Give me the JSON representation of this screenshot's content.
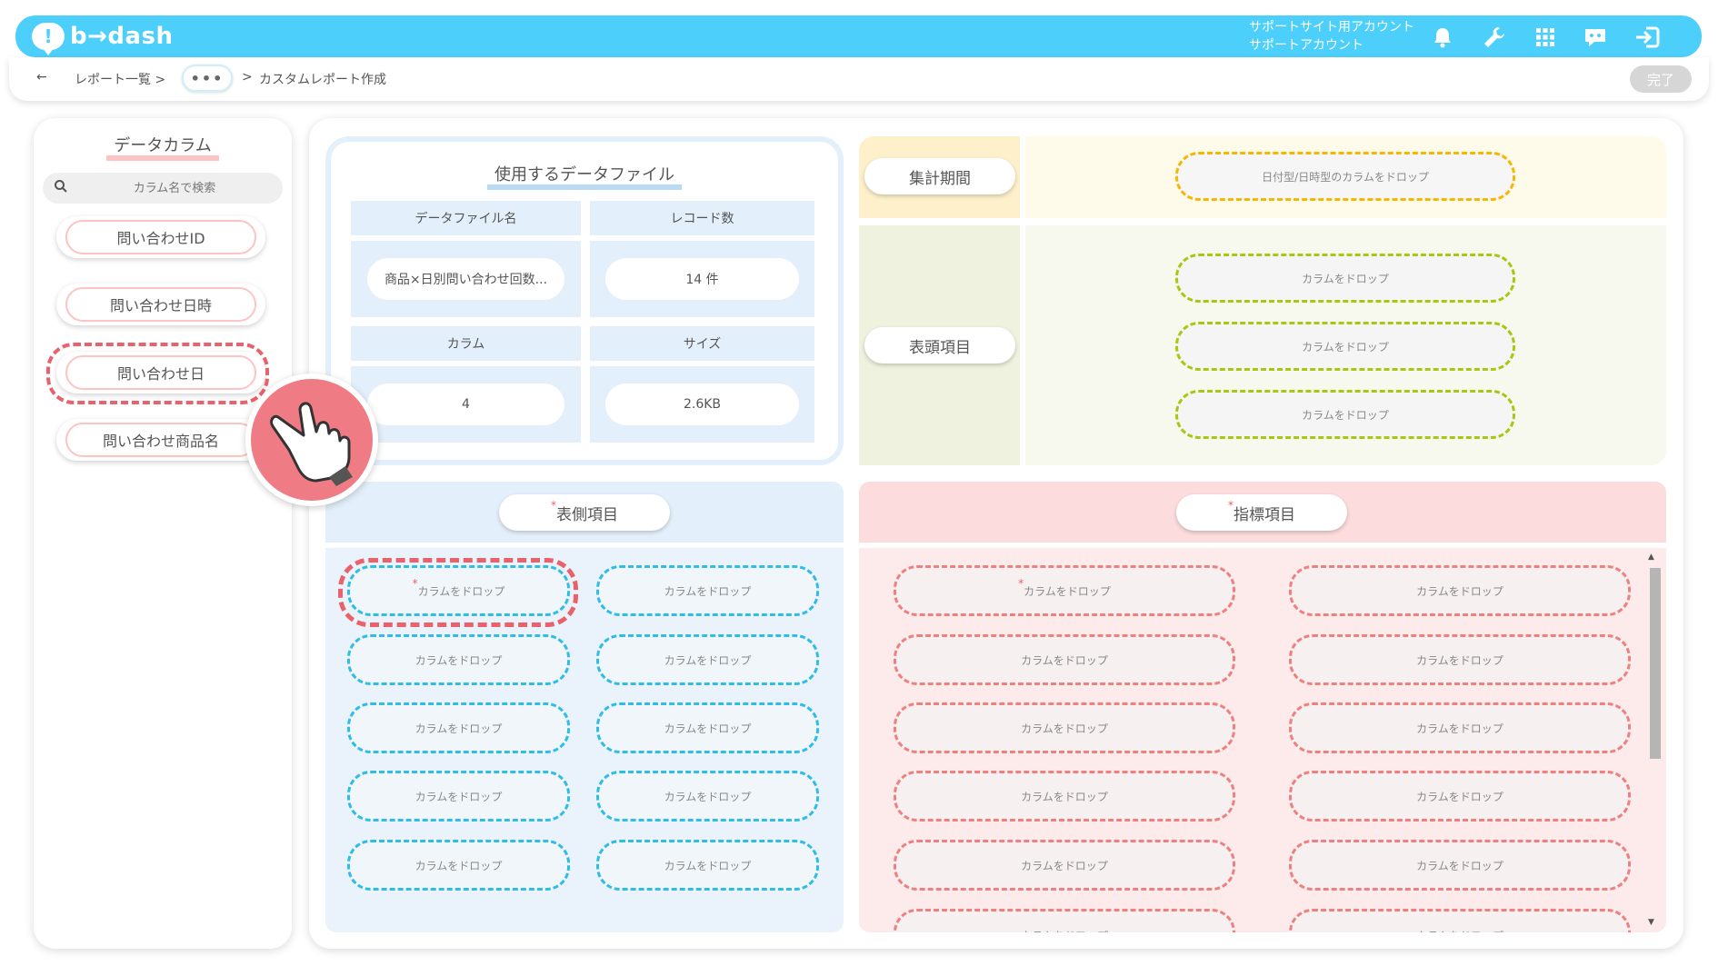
{
  "header": {
    "logo_text": "b→dash",
    "account_line1": "サポートサイト用アカウント",
    "account_line2": "サポートアカウント",
    "icons": [
      "bell-icon",
      "wrench-icon",
      "grid-icon",
      "support-chat-icon",
      "logout-icon"
    ]
  },
  "breadcrumb": {
    "back": "←",
    "item1": "レポート一覧 >",
    "more": "•••",
    "sep": ">",
    "current": "カスタムレポート作成",
    "done": "完了"
  },
  "left_panel": {
    "title": "データカラム",
    "search_placeholder": "カラム名で検索",
    "columns": [
      "問い合わせID",
      "問い合わせ日時",
      "問い合わせ日",
      "問い合わせ商品名"
    ]
  },
  "file_card": {
    "title": "使用するデータファイル",
    "headers": [
      "データファイル名",
      "レコード数",
      "カラム",
      "サイズ"
    ],
    "values": [
      "商品×日別問い合わせ回数...",
      "14 件",
      "4",
      "2.6KB"
    ]
  },
  "period": {
    "label": "集計期間",
    "drop": "日付型/日時型のカラムをドロップ"
  },
  "table_header": {
    "label": "表頭項目",
    "drops": [
      "カラムをドロップ",
      "カラムをドロップ",
      "カラムをドロップ"
    ]
  },
  "rows": {
    "required": "*",
    "label": "表側項目",
    "drops": [
      "カラムをドロップ",
      "カラムをドロップ",
      "カラムをドロップ",
      "カラムをドロップ",
      "カラムをドロップ",
      "カラムをドロップ",
      "カラムをドロップ",
      "カラムをドロップ",
      "カラムをドロップ",
      "カラムをドロップ"
    ]
  },
  "metrics": {
    "required": "*",
    "label": "指標項目",
    "drops": [
      "カラムをドロップ",
      "カラムをドロップ",
      "カラムをドロップ",
      "カラムをドロップ",
      "カラムをドロップ",
      "カラムをドロップ",
      "カラムをドロップ",
      "カラムをドロップ",
      "カラムをドロップ",
      "カラムをドロップ",
      "カラムをドロップ",
      "カラムをドロップ"
    ]
  }
}
